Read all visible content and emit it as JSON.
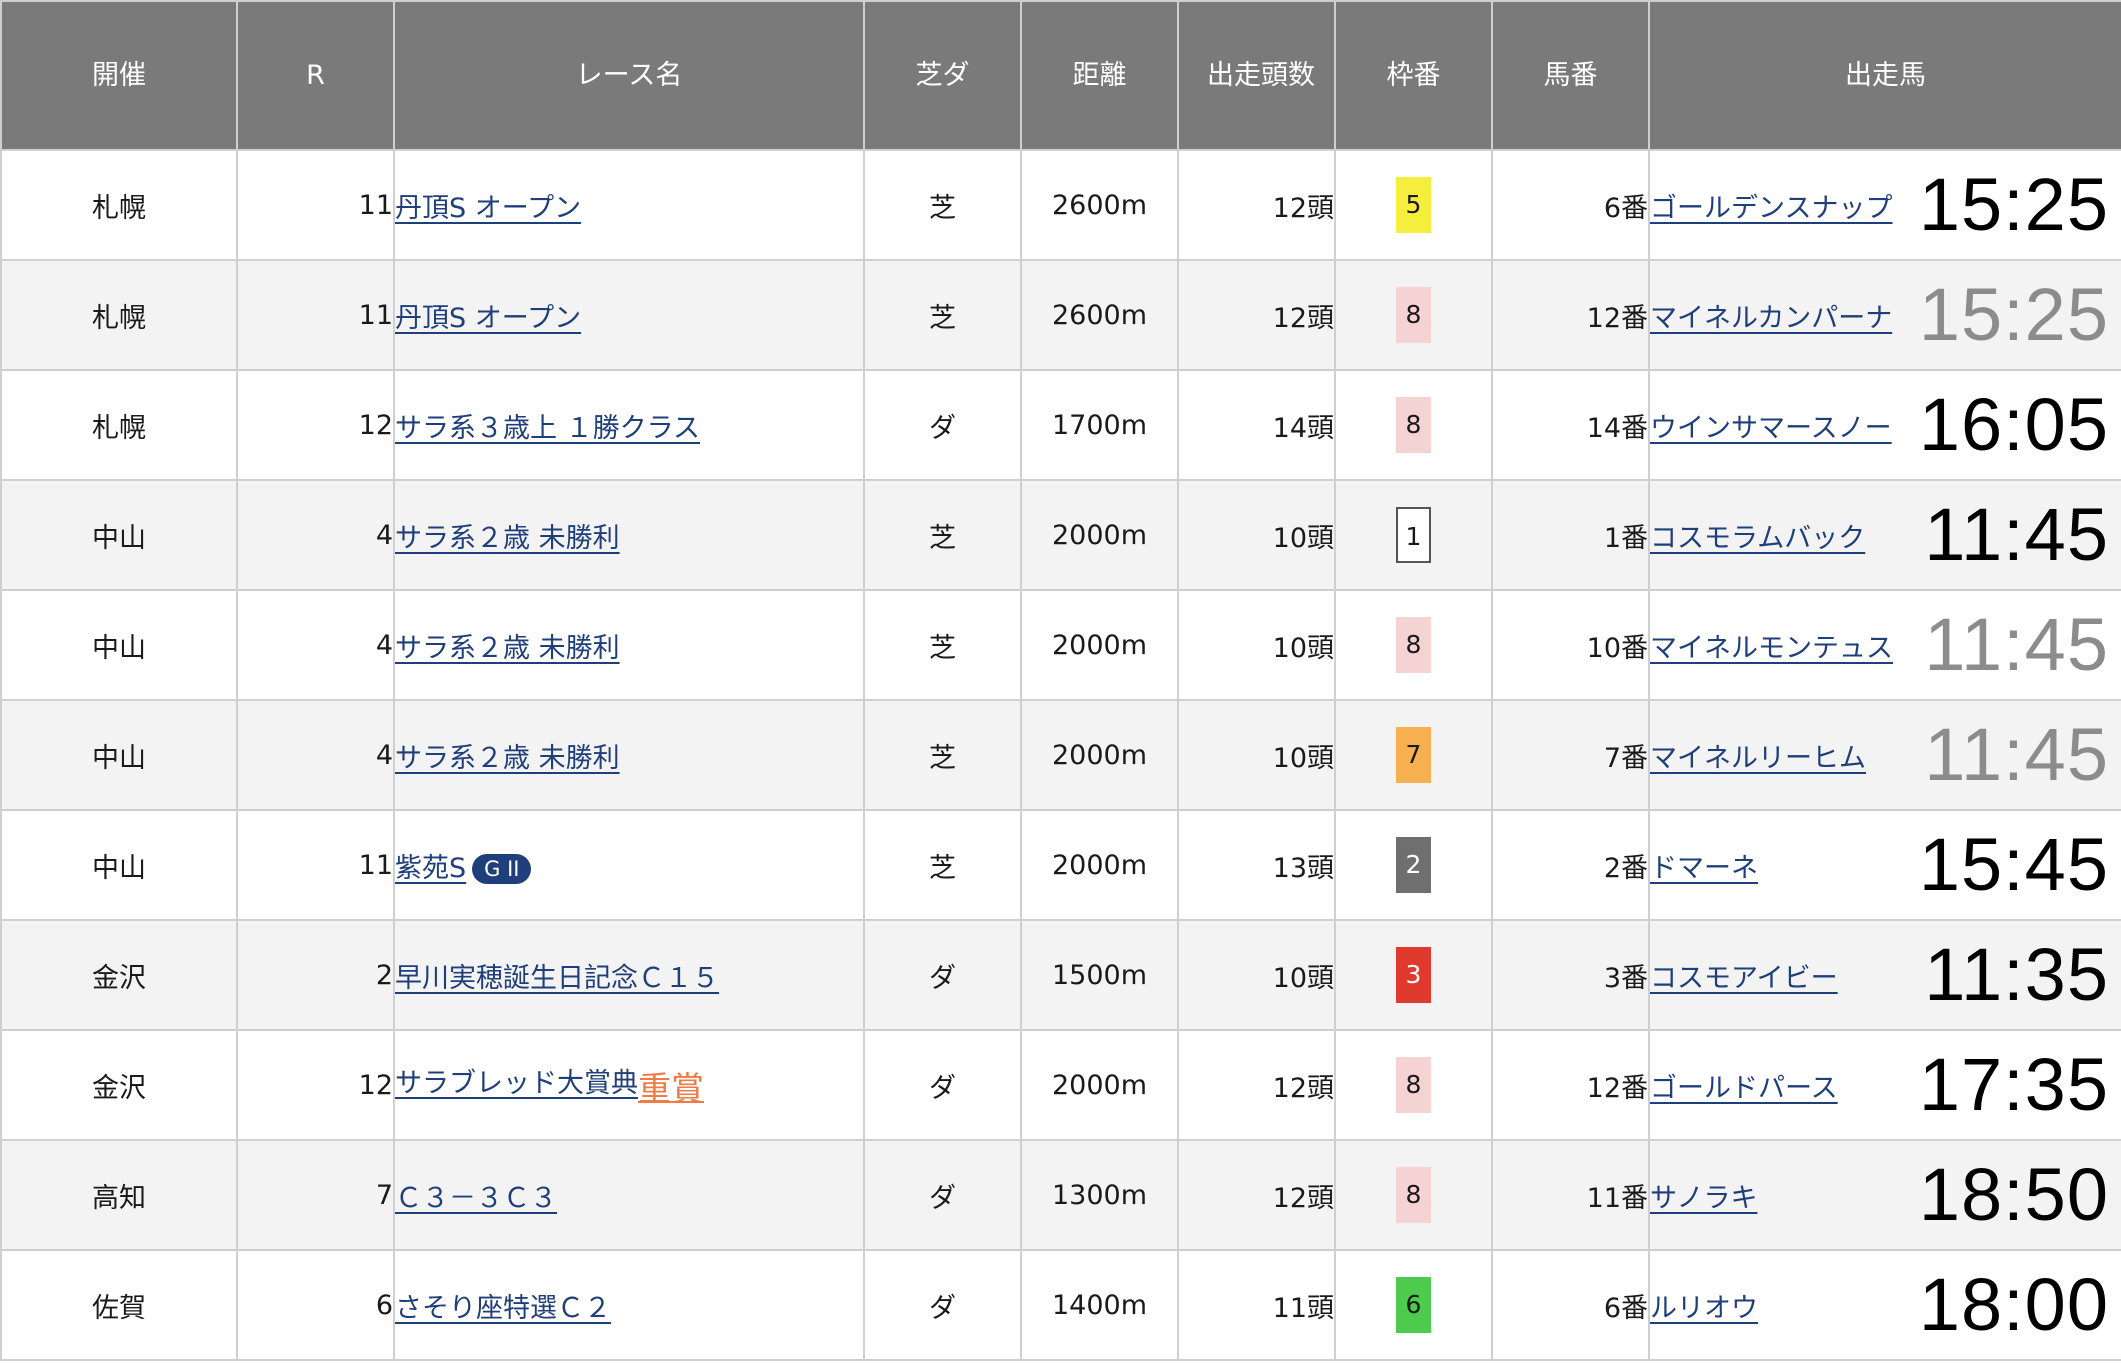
{
  "columns": [
    "開催",
    "R",
    "レース名",
    "芝ダ",
    "距離",
    "出走頭数",
    "枠番",
    "馬番",
    "出走馬"
  ],
  "colors": {
    "header_bg": "#7a7a7a",
    "link": "#1f3f7a",
    "jusho": "#ef7b45"
  },
  "rows": [
    {
      "venue": "札幌",
      "r": "11",
      "race": "丹頂S オープン",
      "grade": "",
      "jusho": "",
      "surface": "芝",
      "distance": "2600m",
      "heads": "12頭",
      "waku": "5",
      "waku_bg": "#f5ee3c",
      "waku_fg": "#1a1a1a",
      "waku_border": "none",
      "umaban": "6番",
      "horse": "ゴールデンスナップ",
      "time": "15:25",
      "time_dim": false
    },
    {
      "venue": "札幌",
      "r": "11",
      "race": "丹頂S オープン",
      "grade": "",
      "jusho": "",
      "surface": "芝",
      "distance": "2600m",
      "heads": "12頭",
      "waku": "8",
      "waku_bg": "#f6d3d3",
      "waku_fg": "#1a1a1a",
      "waku_border": "none",
      "umaban": "12番",
      "horse": "マイネルカンパーナ",
      "time": "15:25",
      "time_dim": true
    },
    {
      "venue": "札幌",
      "r": "12",
      "race": "サラ系３歳上 １勝クラス",
      "grade": "",
      "jusho": "",
      "surface": "ダ",
      "distance": "1700m",
      "heads": "14頭",
      "waku": "8",
      "waku_bg": "#f6d3d3",
      "waku_fg": "#1a1a1a",
      "waku_border": "none",
      "umaban": "14番",
      "horse": "ウインサマースノー",
      "time": "16:05",
      "time_dim": false
    },
    {
      "venue": "中山",
      "r": "4",
      "race": "サラ系２歳 未勝利",
      "grade": "",
      "jusho": "",
      "surface": "芝",
      "distance": "2000m",
      "heads": "10頭",
      "waku": "1",
      "waku_bg": "#ffffff",
      "waku_fg": "#1a1a1a",
      "waku_border": "2px solid #555555",
      "umaban": "1番",
      "horse": "コスモラムバック",
      "time": "11:45",
      "time_dim": false
    },
    {
      "venue": "中山",
      "r": "4",
      "race": "サラ系２歳 未勝利",
      "grade": "",
      "jusho": "",
      "surface": "芝",
      "distance": "2000m",
      "heads": "10頭",
      "waku": "8",
      "waku_bg": "#f6d3d3",
      "waku_fg": "#1a1a1a",
      "waku_border": "none",
      "umaban": "10番",
      "horse": "マイネルモンテュス",
      "time": "11:45",
      "time_dim": true
    },
    {
      "venue": "中山",
      "r": "4",
      "race": "サラ系２歳 未勝利",
      "grade": "",
      "jusho": "",
      "surface": "芝",
      "distance": "2000m",
      "heads": "10頭",
      "waku": "7",
      "waku_bg": "#f7b04f",
      "waku_fg": "#1a1a1a",
      "waku_border": "none",
      "umaban": "7番",
      "horse": "マイネルリーヒム",
      "time": "11:45",
      "time_dim": true
    },
    {
      "venue": "中山",
      "r": "11",
      "race": "紫苑S",
      "grade": "G II",
      "jusho": "",
      "surface": "芝",
      "distance": "2000m",
      "heads": "13頭",
      "waku": "2",
      "waku_bg": "#6f6f6f",
      "waku_fg": "#ffffff",
      "waku_border": "none",
      "umaban": "2番",
      "horse": "ドマーネ",
      "time": "15:45",
      "time_dim": false
    },
    {
      "venue": "金沢",
      "r": "2",
      "race": "早川実穂誕生日記念Ｃ１５",
      "grade": "",
      "jusho": "",
      "surface": "ダ",
      "distance": "1500m",
      "heads": "10頭",
      "waku": "3",
      "waku_bg": "#e03a2f",
      "waku_fg": "#ffffff",
      "waku_border": "none",
      "umaban": "3番",
      "horse": "コスモアイビー",
      "time": "11:35",
      "time_dim": false
    },
    {
      "venue": "金沢",
      "r": "12",
      "race": "サラブレッド大賞典",
      "grade": "",
      "jusho": "重賞",
      "surface": "ダ",
      "distance": "2000m",
      "heads": "12頭",
      "waku": "8",
      "waku_bg": "#f6d3d3",
      "waku_fg": "#1a1a1a",
      "waku_border": "none",
      "umaban": "12番",
      "horse": "ゴールドパース",
      "time": "17:35",
      "time_dim": false
    },
    {
      "venue": "高知",
      "r": "7",
      "race": "Ｃ３－３Ｃ３",
      "grade": "",
      "jusho": "",
      "surface": "ダ",
      "distance": "1300m",
      "heads": "12頭",
      "waku": "8",
      "waku_bg": "#f6d3d3",
      "waku_fg": "#1a1a1a",
      "waku_border": "none",
      "umaban": "11番",
      "horse": "サノラキ",
      "time": "18:50",
      "time_dim": false
    },
    {
      "venue": "佐賀",
      "r": "6",
      "race": "さそり座特選Ｃ２",
      "grade": "",
      "jusho": "",
      "surface": "ダ",
      "distance": "1400m",
      "heads": "11頭",
      "waku": "6",
      "waku_bg": "#4ccb4c",
      "waku_fg": "#1a1a1a",
      "waku_border": "none",
      "umaban": "6番",
      "horse": "ルリオウ",
      "time": "18:00",
      "time_dim": false
    }
  ]
}
